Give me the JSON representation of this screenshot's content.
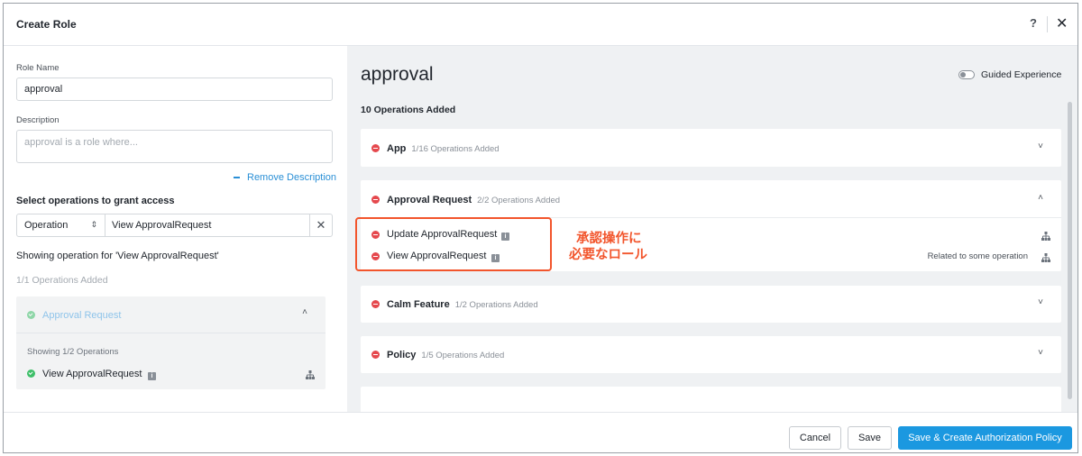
{
  "header": {
    "title": "Create Role",
    "help_label": "?",
    "close_label": "✕"
  },
  "left": {
    "role_name_label": "Role Name",
    "role_name_value": "approval",
    "description_label": "Description",
    "description_placeholder": "approval is a role where...",
    "remove_description": "Remove Description",
    "select_ops_title": "Select operations to grant access",
    "filter_type": "Operation",
    "filter_value": "View ApprovalRequest",
    "showing_text": "Showing operation for 'View ApprovalRequest'",
    "ops_added": "1/1 Operations Added",
    "card": {
      "name": "Approval Request",
      "sub": "Showing 1/2 Operations",
      "operation": "View ApprovalRequest"
    }
  },
  "right": {
    "role_title": "approval",
    "guided_experience": "Guided Experience",
    "guided_enabled": false,
    "ops_count": "10 Operations Added",
    "groups": [
      {
        "name": "App",
        "count": "1/16 Operations Added",
        "expanded": false
      },
      {
        "name": "Approval Request",
        "count": "2/2 Operations Added",
        "expanded": true,
        "operations": [
          {
            "name": "Update ApprovalRequest",
            "note": ""
          },
          {
            "name": "View ApprovalRequest",
            "note": "Related to some operation"
          }
        ]
      },
      {
        "name": "Calm Feature",
        "count": "1/2 Operations Added",
        "expanded": false
      },
      {
        "name": "Policy",
        "count": "1/5 Operations Added",
        "expanded": false
      }
    ]
  },
  "annotation": {
    "line1": "承認操作に",
    "line2": "必要なロール",
    "color": "#f2552c"
  },
  "footer": {
    "cancel": "Cancel",
    "save": "Save",
    "save_create": "Save & Create Authorization Policy"
  },
  "colors": {
    "accent": "#1b98e0",
    "danger": "#e5484d",
    "success": "#3ebf69"
  }
}
